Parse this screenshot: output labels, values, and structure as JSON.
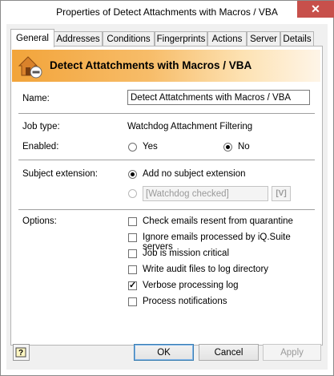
{
  "window": {
    "title": "Properties of Detect Attachments with Macros / VBA",
    "close_glyph": "✕"
  },
  "tabs": [
    {
      "label": "General",
      "active": true
    },
    {
      "label": "Addresses"
    },
    {
      "label": "Conditions"
    },
    {
      "label": "Fingerprints"
    },
    {
      "label": "Actions"
    },
    {
      "label": "Server"
    },
    {
      "label": "Details"
    }
  ],
  "banner": {
    "title": "Detect Attatchments with Macros / VBA"
  },
  "form": {
    "name_label": "Name:",
    "name_value": "Detect Attatchments with Macros / VBA",
    "job_type_label": "Job type:",
    "job_type_value": "Watchdog Attachment Filtering",
    "enabled_label": "Enabled:",
    "enabled_yes": "Yes",
    "enabled_no": "No",
    "enabled_selected": "No",
    "subject_label": "Subject extension:",
    "subject_option_none": "Add no subject extension",
    "subject_ext_value": "[Watchdog checked]",
    "subject_ext_button": "[V]",
    "options_label": "Options:",
    "options": [
      {
        "label": "Check emails resent from quarantine",
        "checked": false
      },
      {
        "label": "Ignore emails processed by iQ.Suite servers",
        "checked": false
      },
      {
        "label": "Job is mission critical",
        "checked": false
      },
      {
        "label": "Write audit files to log directory",
        "checked": false
      },
      {
        "label": "Verbose processing log",
        "checked": true
      },
      {
        "label": "Process notifications",
        "checked": false
      }
    ]
  },
  "buttons": {
    "ok": "OK",
    "cancel": "Cancel",
    "apply": "Apply"
  },
  "colors": {
    "banner_start": "#f2a43a",
    "banner_end": "#fef5e8",
    "close_button": "#c7504b"
  }
}
